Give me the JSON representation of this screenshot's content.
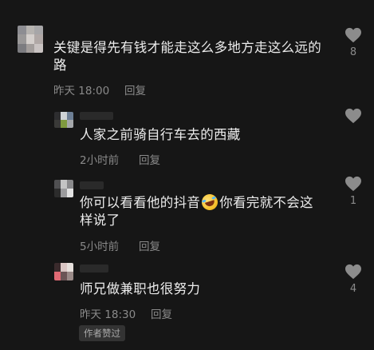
{
  "comments": [
    {
      "text_line1": "关键是得先有钱才能走这么多地方走这么远的",
      "text_line2": "路",
      "time": "昨天 18:00",
      "reply_label": "回复",
      "like_count": "8"
    },
    {
      "text": "人家之前骑自行车去的西藏",
      "time": "2小时前",
      "reply_label": "回复",
      "like_count": ""
    },
    {
      "text_part1": "你可以看看他的抖音",
      "emoji": "rolling-laughing-emoji",
      "text_part2": "你看完就不会这",
      "text_line2": "样说了",
      "time": "5小时前",
      "reply_label": "回复",
      "like_count": "1"
    },
    {
      "text": "师兄做兼职也很努力",
      "time": "昨天 18:30",
      "reply_label": "回复",
      "like_count": "4",
      "badge": "作者赞过"
    }
  ],
  "colors": {
    "background": "#161616",
    "text": "#ececec",
    "meta": "#8a8a8a",
    "heart": "#8c8c8c"
  }
}
